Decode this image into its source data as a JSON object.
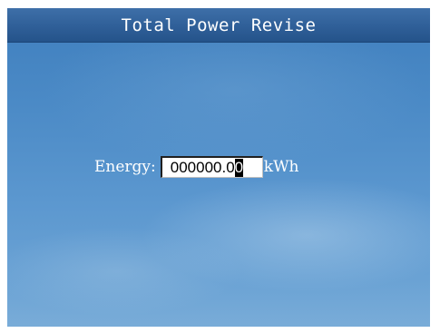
{
  "window": {
    "title": "Total Power Revise"
  },
  "energy": {
    "label": "Energy:",
    "value_prefix": "000000.0",
    "value_cursor_char": "0",
    "unit": "kWh"
  }
}
